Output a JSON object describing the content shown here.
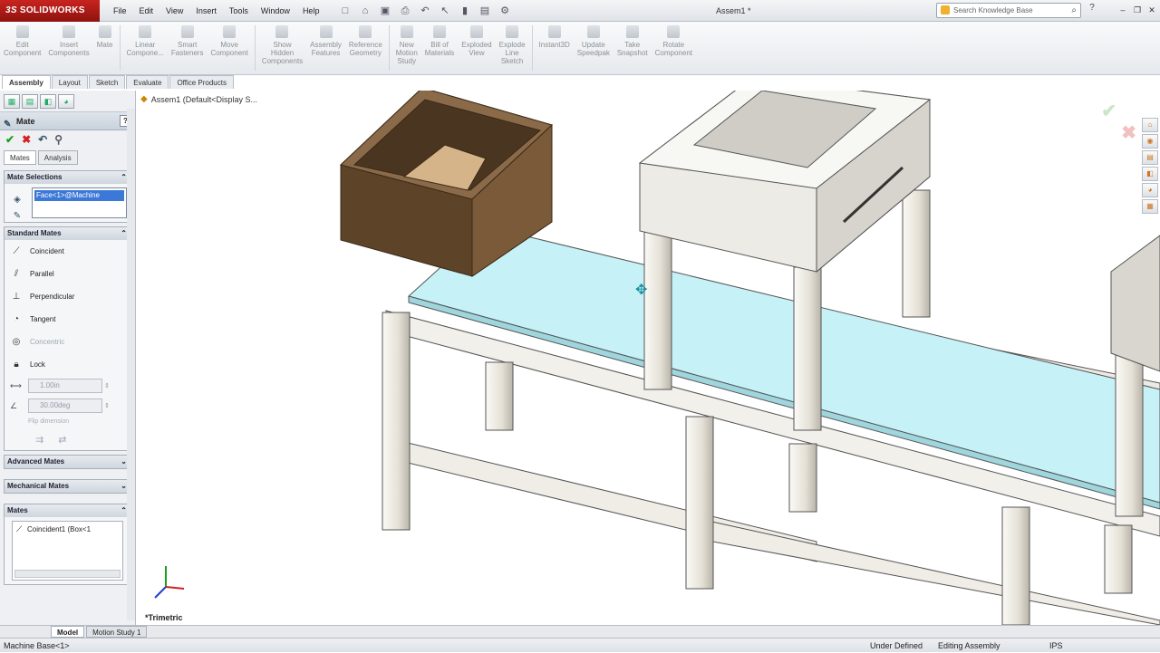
{
  "app": {
    "logo": "SOLIDWORKS",
    "logo_prefix": "3S",
    "document_title": "Assem1 *"
  },
  "menu": [
    "File",
    "Edit",
    "View",
    "Insert",
    "Tools",
    "Window",
    "Help"
  ],
  "search": {
    "placeholder": "Search Knowledge Base"
  },
  "command_manager": [
    [
      "Edit",
      "Component"
    ],
    [
      "Insert",
      "Components"
    ],
    [
      "Mate",
      ""
    ],
    [
      "Linear",
      "Compone..."
    ],
    [
      "Smart",
      "Fasteners"
    ],
    [
      "Move",
      "Component"
    ],
    [
      "Show",
      "Hidden",
      "Components"
    ],
    [
      "Assembly",
      "Features"
    ],
    [
      "Reference",
      "Geometry"
    ],
    [
      "New",
      "Motion",
      "Study"
    ],
    [
      "Bill of",
      "Materials"
    ],
    [
      "Exploded",
      "View"
    ],
    [
      "Explode",
      "Line",
      "Sketch"
    ],
    [
      "Instant3D",
      ""
    ],
    [
      "Update",
      "Speedpak"
    ],
    [
      "Take",
      "Snapshot"
    ],
    [
      "Rotate",
      "Component"
    ]
  ],
  "tabs": {
    "items": [
      "Assembly",
      "Layout",
      "Sketch",
      "Evaluate",
      "Office Products"
    ],
    "active": "Assembly"
  },
  "property_manager": {
    "title": "Mate",
    "subtabs": [
      "Mates",
      "Analysis"
    ],
    "mate_selections": {
      "header": "Mate Selections",
      "selected": "Face<1>@Machine"
    },
    "standard_mates": {
      "header": "Standard Mates",
      "items": [
        {
          "label": "Coincident",
          "icon": "coincident-icon",
          "enabled": true
        },
        {
          "label": "Parallel",
          "icon": "parallel-icon",
          "enabled": true
        },
        {
          "label": "Perpendicular",
          "icon": "perpendicular-icon",
          "enabled": true
        },
        {
          "label": "Tangent",
          "icon": "tangent-icon",
          "enabled": true
        },
        {
          "label": "Concentric",
          "icon": "concentric-icon",
          "enabled": false
        },
        {
          "label": "Lock",
          "icon": "lock-icon",
          "enabled": true
        }
      ],
      "distance_value": "1.00in",
      "angle_value": "30.00deg",
      "flip_label": "Flip dimension"
    },
    "advanced_mates": {
      "header": "Advanced Mates"
    },
    "mechanical_mates": {
      "header": "Mechanical Mates"
    },
    "mates": {
      "header": "Mates",
      "items": [
        "Coincident1 (Box<1"
      ]
    }
  },
  "feature_tree": {
    "root": "Assem1 (Default<Display S..."
  },
  "viewport": {
    "view_label": "*Trimetric"
  },
  "bottom_tabs": {
    "items": [
      "Model",
      "Motion Study 1"
    ],
    "active": "Model"
  },
  "status_bar": {
    "left": "Machine Base<1>",
    "definition": "Under Defined",
    "mode": "Editing Assembly",
    "units": "IPS"
  },
  "colors": {
    "logo_red": "#b01c18",
    "conveyor_belt": "#c6f1f7",
    "box_brown": "#6b4e30",
    "ok_green": "#1f9f1f",
    "cancel_red": "#d42020"
  }
}
